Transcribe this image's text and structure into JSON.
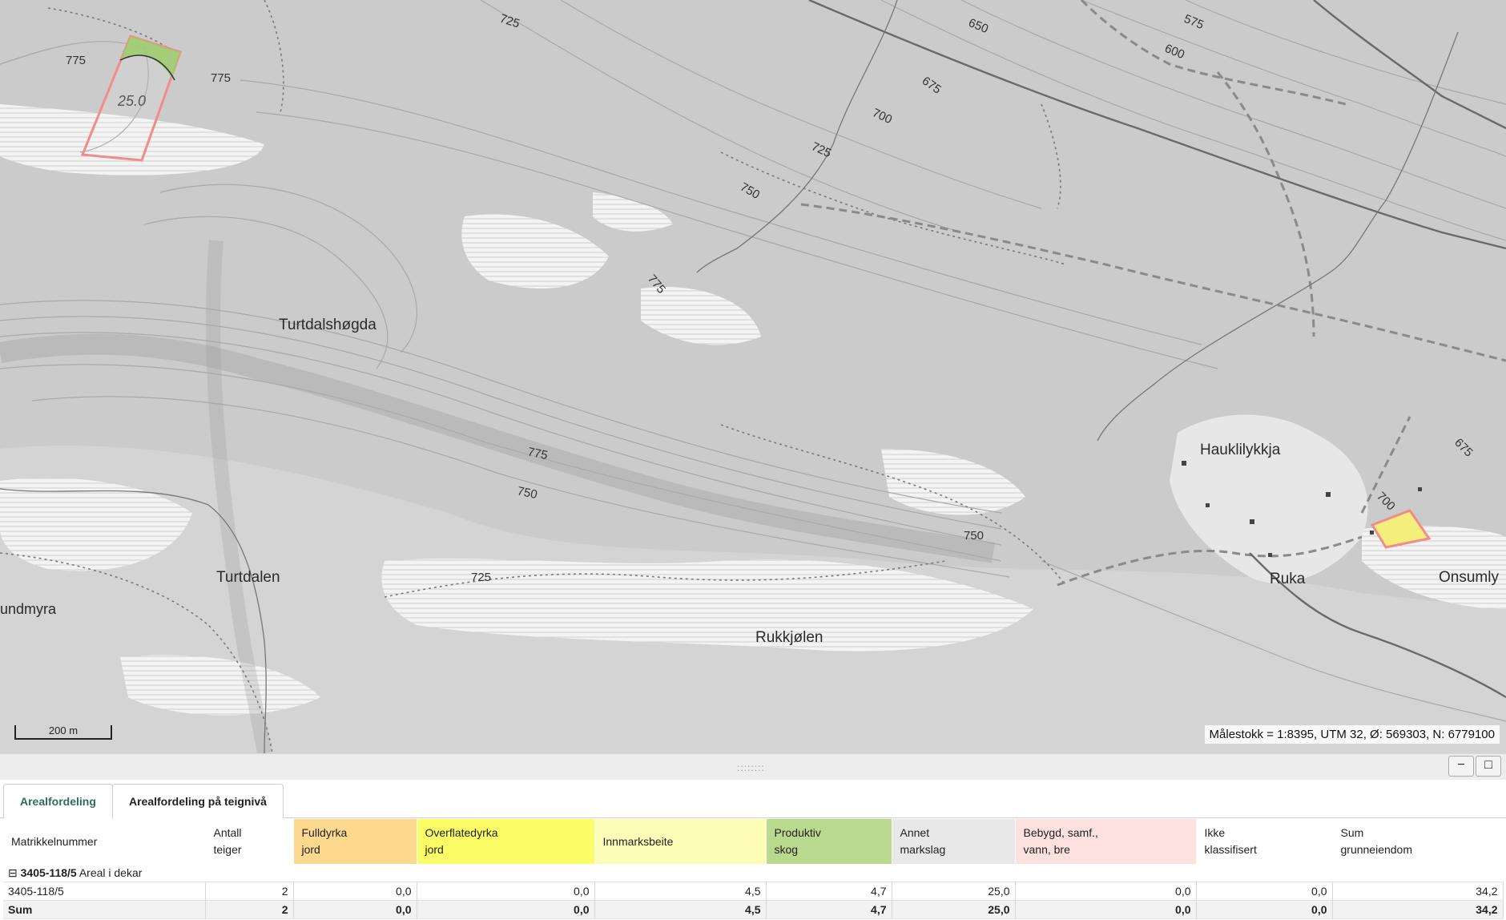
{
  "map": {
    "place_names": {
      "turtdalshogda": "Turtdalshøgda",
      "turtdalen": "Turtdalen",
      "undmyra": "undmyra",
      "rukkjolen": "Rukkjølen",
      "hauklilykkja": "Hauklilykkja",
      "ruka": "Ruka",
      "onsumly": "Onsumly"
    },
    "contour_labels": [
      "725",
      "775",
      "775",
      "650",
      "575",
      "600",
      "675",
      "700",
      "725",
      "750",
      "775",
      "775",
      "750",
      "750",
      "725",
      "675",
      "700"
    ],
    "parcel_label": "25.0",
    "scalebar_label": "200 m",
    "scale_info": "Målestokk = 1:8395, UTM 32, Ø: 569303, N: 6779100"
  },
  "panel": {
    "grip": "::::::::",
    "minimize_icon": "−",
    "maximize_icon": "□",
    "tabs": [
      "Arealfordeling",
      "Arealfordeling på teignivå"
    ],
    "columns": [
      {
        "line1": "Matrikkelnummer",
        "line2": "",
        "color": "#ffffff"
      },
      {
        "line1": "Antall",
        "line2": "teiger",
        "color": "#ffffff"
      },
      {
        "line1": "Fulldyrka",
        "line2": "jord",
        "color": "#fdd88f"
      },
      {
        "line1": "Overflatedyrka",
        "line2": "jord",
        "color": "#fcfc66"
      },
      {
        "line1": "Innmarksbeite",
        "line2": "",
        "color": "#fdfdb8"
      },
      {
        "line1": "Produktiv",
        "line2": "skog",
        "color": "#b9d98f"
      },
      {
        "line1": "Annet",
        "line2": "markslag",
        "color": "#e8e8e8"
      },
      {
        "line1": "Bebygd, samf.,",
        "line2": "vann, bre",
        "color": "#fde1de"
      },
      {
        "line1": "Ikke",
        "line2": "klassifisert",
        "color": "#ffffff"
      },
      {
        "line1": "Sum",
        "line2": "grunneiendom",
        "color": "#ffffff"
      }
    ],
    "group": {
      "toggle": "⊟",
      "id": "3405-118/5",
      "suffix": "Areal i dekar"
    },
    "rows": [
      [
        "3405-118/5",
        "2",
        "0,0",
        "0,0",
        "4,5",
        "4,7",
        "25,0",
        "0,0",
        "0,0",
        "34,2"
      ]
    ],
    "sum_row": [
      "Sum",
      "2",
      "0,0",
      "0,0",
      "4,5",
      "4,7",
      "25,0",
      "0,0",
      "0,0",
      "34,2"
    ]
  }
}
